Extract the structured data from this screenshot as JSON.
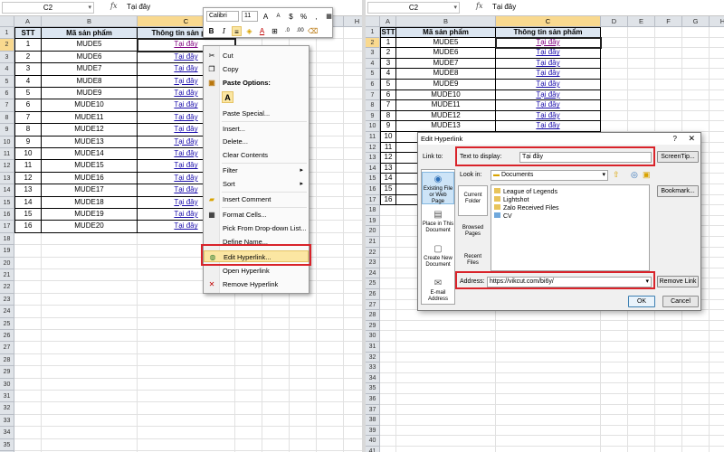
{
  "name_box": "C2",
  "fx_label": "fx",
  "formula_value": "Tại đây",
  "col_headers": [
    "A",
    "B",
    "C",
    "D",
    "E",
    "F",
    "G",
    "H"
  ],
  "table_headers": [
    "STT",
    "Mã sản phẩm",
    "Thông tin sản phẩm"
  ],
  "rows": [
    {
      "stt": "1",
      "code": "MUDE5",
      "info": "Tại đây"
    },
    {
      "stt": "2",
      "code": "MUDE6",
      "info": "Tại đây"
    },
    {
      "stt": "3",
      "code": "MUDE7",
      "info": "Tại đây"
    },
    {
      "stt": "4",
      "code": "MUDE8",
      "info": "Tại đây"
    },
    {
      "stt": "5",
      "code": "MUDE9",
      "info": "Tại đây"
    },
    {
      "stt": "6",
      "code": "MUDE10",
      "info": "Tại đây"
    },
    {
      "stt": "7",
      "code": "MUDE11",
      "info": "Tại đây"
    },
    {
      "stt": "8",
      "code": "MUDE12",
      "info": "Tại đây"
    },
    {
      "stt": "9",
      "code": "MUDE13",
      "info": "Tại đây"
    },
    {
      "stt": "10",
      "code": "MUDE14",
      "info": "Tại đây"
    },
    {
      "stt": "11",
      "code": "MUDE15",
      "info": "Tại đây"
    },
    {
      "stt": "12",
      "code": "MUDE16",
      "info": "Tại đây"
    },
    {
      "stt": "13",
      "code": "MUDE17",
      "info": "Tại đây"
    },
    {
      "stt": "14",
      "code": "MUDE18",
      "info": "Tại đây"
    },
    {
      "stt": "15",
      "code": "MUDE19",
      "info": "Tại đây"
    },
    {
      "stt": "16",
      "code": "MUDE20",
      "info": "Tại đây"
    }
  ],
  "mini_toolbar": {
    "font": "Calibri",
    "size": "11",
    "bold": "B",
    "italic": "I",
    "currency": "$",
    "percent": "%"
  },
  "context_menu": {
    "cut": "Cut",
    "copy": "Copy",
    "paste_options": "Paste Options:",
    "paste_icon": "A",
    "paste_special": "Paste Special...",
    "insert": "Insert...",
    "delete": "Delete...",
    "clear_contents": "Clear Contents",
    "filter": "Filter",
    "sort": "Sort",
    "insert_comment": "Insert Comment",
    "format_cells": "Format Cells...",
    "pick_list": "Pick From Drop-down List...",
    "define_name": "Define Name...",
    "edit_hyperlink": "Edit Hyperlink...",
    "open_hyperlink": "Open Hyperlink",
    "remove_hyperlink": "Remove Hyperlink"
  },
  "dialog": {
    "title": "Edit Hyperlink",
    "help": "?",
    "close": "✕",
    "link_to": "Link to:",
    "text_to_display_label": "Text to display:",
    "text_to_display_value": "Tại đây",
    "screentip": "ScreenTip...",
    "look_in_label": "Look in:",
    "look_in_value": "Documents",
    "bookmark": "Bookmark...",
    "link_types": [
      "Existing File or Web Page",
      "Place in This Document",
      "Create New Document",
      "E-mail Address"
    ],
    "side_buttons": [
      "Current Folder",
      "Browsed Pages",
      "Recent Files"
    ],
    "files": [
      "League of Legends",
      "Lightshot",
      "Zalo Received Files",
      "CV"
    ],
    "address_label": "Address:",
    "address_value": "https://vikcut.com/bi6y/",
    "remove_link": "Remove Link",
    "ok": "OK",
    "cancel": "Cancel"
  },
  "colors": {
    "header_fill": "#dce6f1",
    "highlight": "#d9232a",
    "selected_header": "#f9d98f"
  }
}
